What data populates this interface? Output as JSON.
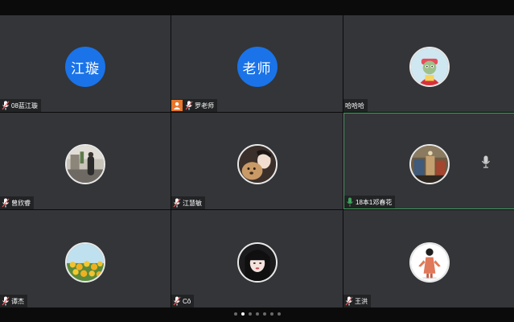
{
  "participants": [
    {
      "name": "08蓝江璇",
      "avatar_text": "江璇",
      "avatar_type": "text",
      "mic": "normal",
      "host": false
    },
    {
      "name": "罗老师",
      "avatar_text": "老师",
      "avatar_type": "text",
      "mic": "normal",
      "host": true
    },
    {
      "name": "哈哈哈",
      "avatar_type": "photo",
      "avatar_icon": "doll-photo-icon",
      "mic": "none",
      "host": false
    },
    {
      "name": "曾欣睿",
      "avatar_type": "photo",
      "avatar_icon": "street-photo-icon",
      "mic": "normal",
      "host": false
    },
    {
      "name": "江慧敏",
      "avatar_type": "photo",
      "avatar_icon": "girl-with-dog-photo-icon",
      "mic": "normal",
      "host": false
    },
    {
      "name": "18本1邓春花",
      "avatar_type": "photo",
      "avatar_icon": "room-photo-icon",
      "mic": "speaking",
      "host": false,
      "active": true
    },
    {
      "name": "谭杰",
      "avatar_type": "photo",
      "avatar_icon": "flowers-photo-icon",
      "mic": "normal",
      "host": false
    },
    {
      "name": "Cô",
      "avatar_type": "photo",
      "avatar_icon": "girl-portrait-photo-icon",
      "mic": "normal",
      "host": false
    },
    {
      "name": "王洪",
      "avatar_type": "photo",
      "avatar_icon": "cartoon-figure-photo-icon",
      "mic": "normal",
      "host": false
    }
  ],
  "pager": {
    "total": 7,
    "current": 0
  },
  "colors": {
    "tile_bg": "#333538",
    "text_avatar_bg": "#1a73e8",
    "active_border": "#3da35d",
    "host_badge": "#e8762c",
    "mic_normal": "#e45a5a",
    "mic_speaking": "#3da35d"
  }
}
